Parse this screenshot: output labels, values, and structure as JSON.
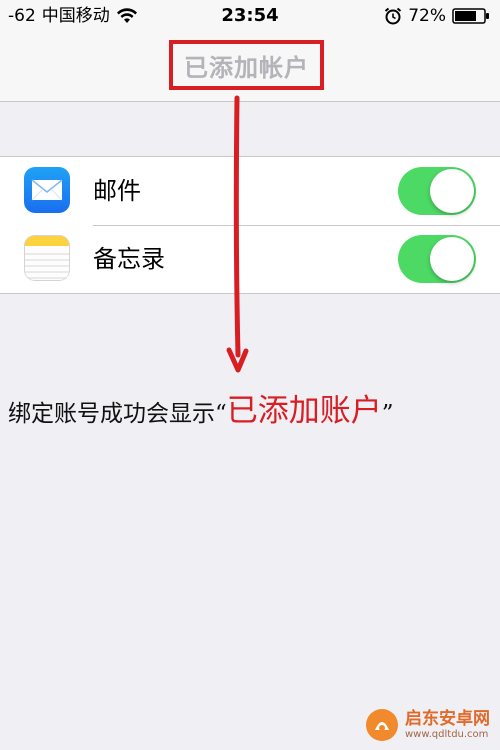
{
  "status_bar": {
    "signal": "-62",
    "carrier": "中国移动",
    "time": "23:54",
    "battery": "72%"
  },
  "nav": {
    "title": "已添加帐户"
  },
  "accounts": [
    {
      "label": "邮件",
      "icon": "mail-icon",
      "enabled": true
    },
    {
      "label": "备忘录",
      "icon": "notes-icon",
      "enabled": true
    }
  ],
  "annotation": {
    "text": "绑定账号成功会显示",
    "open_quote": "“",
    "highlight": "已添加账户",
    "close_quote": "”"
  },
  "watermark": {
    "name": "启东安卓网",
    "url": "www.qdltdu.com"
  },
  "colors": {
    "toggle_on": "#4cd964",
    "annotation_red": "#d81e23",
    "background": "#efeff4"
  }
}
